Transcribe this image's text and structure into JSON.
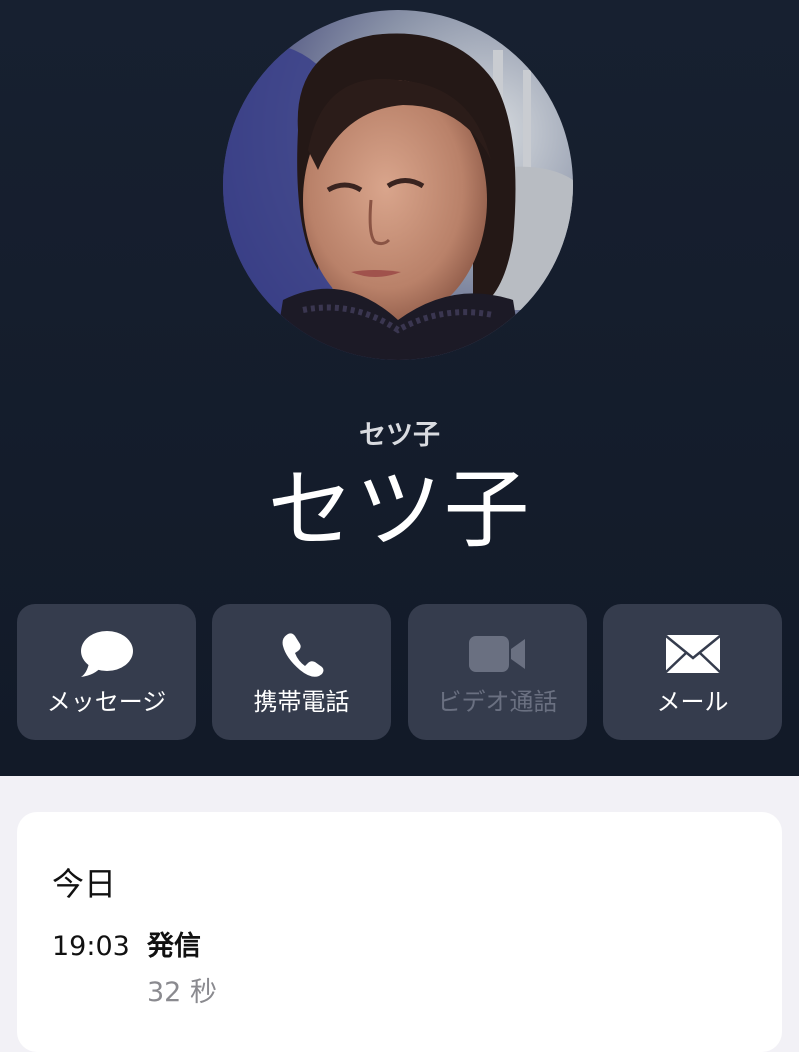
{
  "contact": {
    "small_name": "セツ子",
    "name": "セツ子",
    "photo": "contact-photo"
  },
  "actions": [
    {
      "label": "メッセージ",
      "icon": "speech-bubble-icon",
      "enabled": true
    },
    {
      "label": "携帯電話",
      "icon": "phone-icon",
      "enabled": true
    },
    {
      "label": "ビデオ通話",
      "icon": "video-camera-icon",
      "enabled": false
    },
    {
      "label": "メール",
      "icon": "envelope-icon",
      "enabled": true
    }
  ],
  "call_history": {
    "day": "今日",
    "entries": [
      {
        "time": "19:03",
        "type": "発信",
        "duration": "32 秒"
      }
    ]
  },
  "colors": {
    "header_bg": "#141c2b",
    "button_bg": "#353c4d",
    "page_bg": "#f2f1f6",
    "card_bg": "#ffffff",
    "disabled_text": "#6a7081"
  }
}
